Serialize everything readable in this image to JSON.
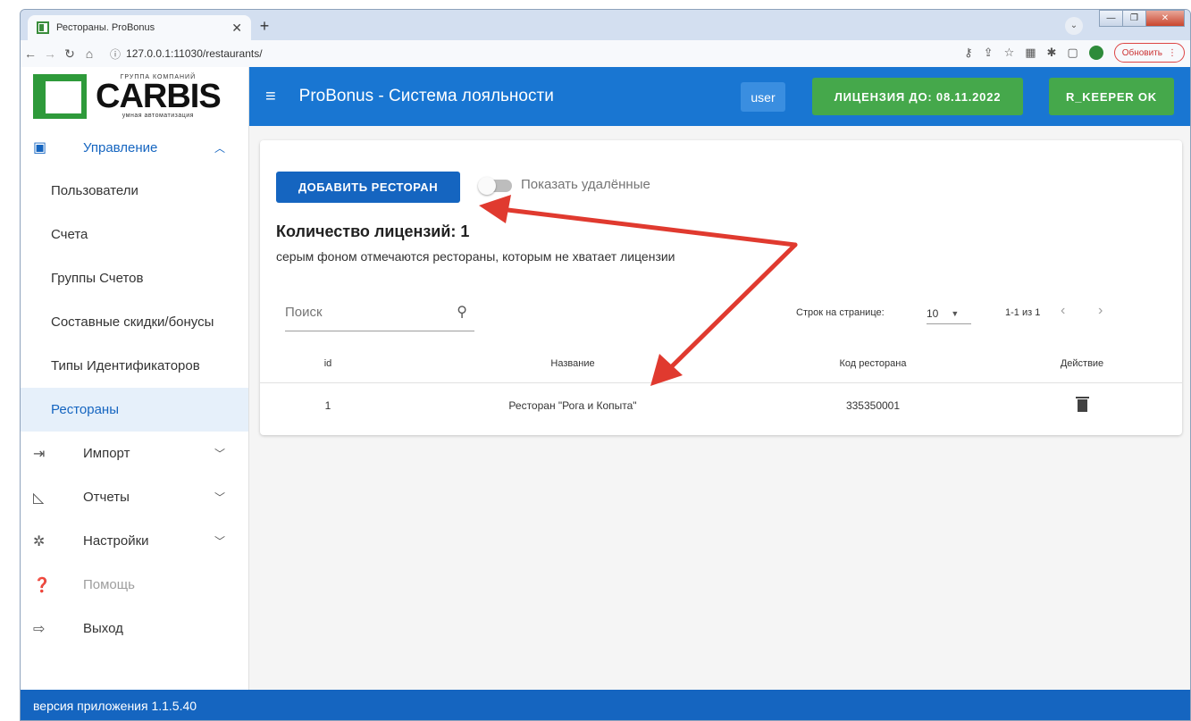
{
  "browser": {
    "tab_title": "Рестораны. ProBonus",
    "tab_close": "✕",
    "new_tab": "+",
    "url": "127.0.0.1:11030/restaurants/",
    "update_label": "Обновить",
    "window_controls": [
      "—",
      "❐",
      "✕"
    ]
  },
  "logo": {
    "top": "ГРУППА КОМПАНИЙ",
    "main": "CARBIS",
    "bottom": "умная автоматизация"
  },
  "topbar": {
    "title": "ProBonus - Система лояльности",
    "user": "user",
    "license": "ЛИЦЕНЗИЯ ДО: 08.11.2022",
    "rkeeper": "R_KEEPER OK",
    "color": "#1976d2"
  },
  "sidebar": {
    "group": {
      "label": "Управление",
      "icon": "clipboard-icon"
    },
    "sub_items": [
      {
        "label": "Пользователи",
        "active": false
      },
      {
        "label": "Счета",
        "active": false
      },
      {
        "label": "Группы Счетов",
        "active": false
      },
      {
        "label": "Составные скидки/бонусы",
        "active": false
      },
      {
        "label": "Типы Идентификаторов",
        "active": false
      },
      {
        "label": "Рестораны",
        "active": true
      }
    ],
    "items": [
      {
        "label": "Импорт",
        "icon": "import-icon",
        "has_chevron": true,
        "disabled": false
      },
      {
        "label": "Отчеты",
        "icon": "chart-icon",
        "has_chevron": true,
        "disabled": false
      },
      {
        "label": "Настройки",
        "icon": "gear-icon",
        "has_chevron": true,
        "disabled": false
      },
      {
        "label": "Помощь",
        "icon": "help-icon",
        "has_chevron": false,
        "disabled": true
      },
      {
        "label": "Выход",
        "icon": "logout-icon",
        "has_chevron": false,
        "disabled": false
      }
    ]
  },
  "main": {
    "add_button": "ДОБАВИТЬ РЕСТОРАН",
    "show_deleted": "Показать удалённые",
    "license_count": "Количество лицензий: 1",
    "license_note": "серым фоном отмечаются рестораны, которым не хватает лицензии",
    "search_placeholder": "Поиск",
    "rows_per_page_label": "Строк на странице:",
    "rows_per_page": "10",
    "page_info": "1-1 из 1",
    "columns": [
      "id",
      "Название",
      "Код ресторана",
      "Действие"
    ],
    "rows": [
      {
        "id": "1",
        "name": "Ресторан \"Рога и Копыта\"",
        "code": "335350001"
      }
    ]
  },
  "footer": {
    "version": "версия приложения 1.1.5.40"
  },
  "colors": {
    "primary": "#1565c0",
    "success": "#45a84b",
    "annotation_arrow": "#e03a2f"
  }
}
